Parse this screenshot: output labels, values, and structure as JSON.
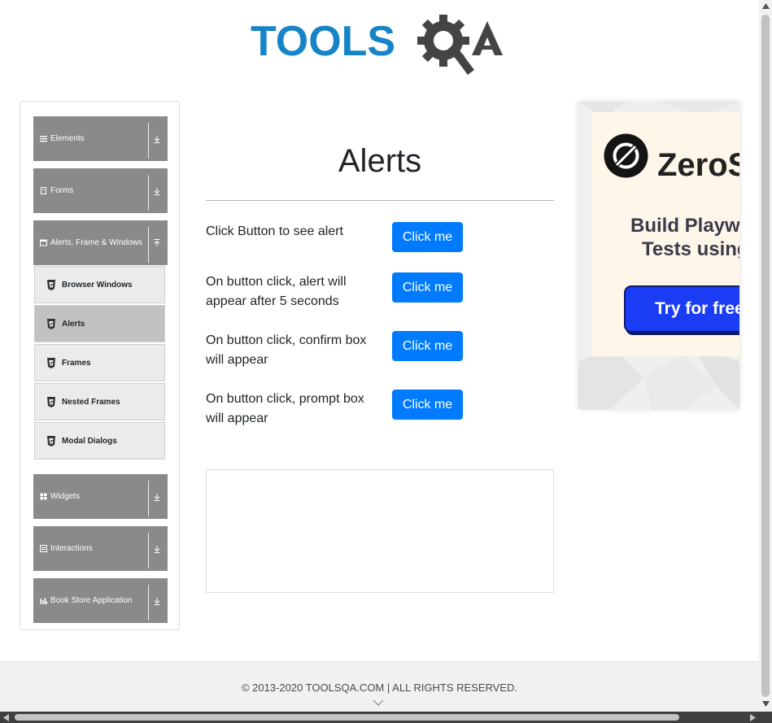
{
  "brand": {
    "logo_text": "TOOLSQA",
    "colors": {
      "tools": "#1784c7",
      "qa": "#444444"
    }
  },
  "sidebar": {
    "groups": [
      {
        "label": "Elements",
        "icon": "menu-icon"
      },
      {
        "label": "Forms",
        "icon": "form-icon"
      },
      {
        "label": "Alerts, Frame & Windows",
        "icon": "window-icon",
        "expanded": true,
        "items": [
          {
            "label": "Browser Windows",
            "icon": "html5-icon"
          },
          {
            "label": "Alerts",
            "icon": "html5-icon",
            "active": true
          },
          {
            "label": "Frames",
            "icon": "html5-icon"
          },
          {
            "label": "Nested Frames",
            "icon": "html5-icon"
          },
          {
            "label": "Modal Dialogs",
            "icon": "html5-icon"
          }
        ]
      },
      {
        "label": "Widgets",
        "icon": "grid-icon"
      },
      {
        "label": "Interactions",
        "icon": "box-icon"
      },
      {
        "label": "Book Store Application",
        "icon": "bar-chart-icon"
      }
    ]
  },
  "main": {
    "title": "Alerts",
    "rows": [
      {
        "text": "Click Button to see alert",
        "button": "Click me"
      },
      {
        "text": "On button click, alert will appear after 5 seconds",
        "button": "Click me"
      },
      {
        "text": "On button click, confirm box will appear",
        "button": "Click me"
      },
      {
        "text": "On button click, prompt box will appear",
        "button": "Click me"
      }
    ]
  },
  "ad": {
    "brand": "ZeroSt",
    "line1": "Build Playwri",
    "line2": "Tests using",
    "cta": "Try for free"
  },
  "footer": {
    "text": "© 2013-2020 TOOLSQA.COM | ALL RIGHTS RESERVED."
  },
  "colors": {
    "primary": "#007bff",
    "sidebar_header": "#8a8a8a",
    "active_item": "#c2c2c2"
  }
}
